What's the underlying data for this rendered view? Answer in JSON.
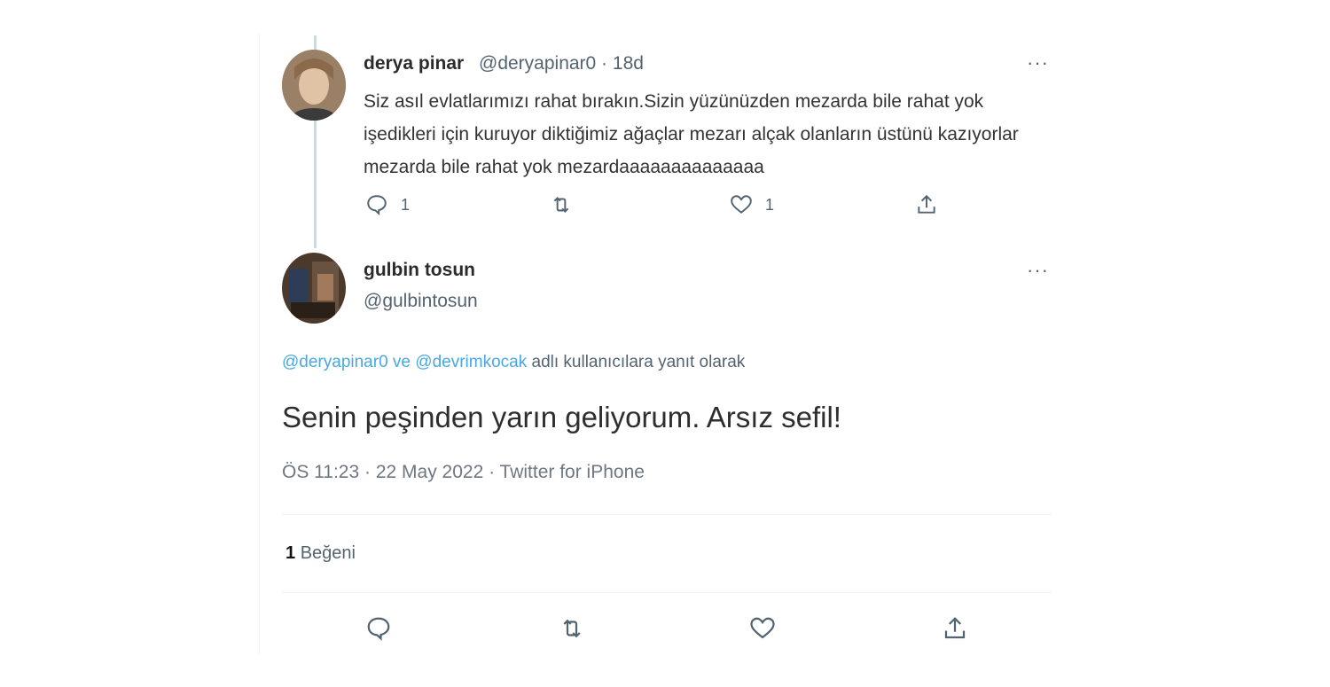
{
  "tweet1": {
    "name": "derya pinar",
    "handle_time": "@deryapinar0 · 18d",
    "text": "Siz asıl evlatlarımızı rahat bırakın.Sizin yüzünüzden mezarda bile rahat yok işedikleri için kuruyor diktiğimiz ağaçlar mezarı alçak olanların üstünü kazıyorlar mezarda bile rahat yok mezardaaaaaaaaaaaaaa",
    "actions": {
      "reply_count": "1",
      "like_count": "1"
    },
    "icons": [
      "reply-icon",
      "retweet-icon",
      "like-icon",
      "share-icon"
    ]
  },
  "tweet2": {
    "name": "gulbin tosun",
    "handle": "@gulbintosun",
    "reply_to": {
      "mention1": "@deryapinar0",
      "connector": "ve",
      "mention2": "@devrimkocak",
      "suffix": "adlı kullanıcılara yanıt olarak"
    },
    "text": "Senin peşinden yarın geliyorum. Arsız sefil!",
    "meta": "ÖS 11:23 · 22 May 2022 · Twitter for iPhone",
    "likes": {
      "count": "1",
      "label": "Beğeni"
    },
    "icons": [
      "reply-icon",
      "retweet-icon",
      "like-icon",
      "share-icon"
    ]
  },
  "colors": {
    "link": "#4aa8e0",
    "secondary_text": "#536471",
    "thread_line": "#cfd9de"
  }
}
